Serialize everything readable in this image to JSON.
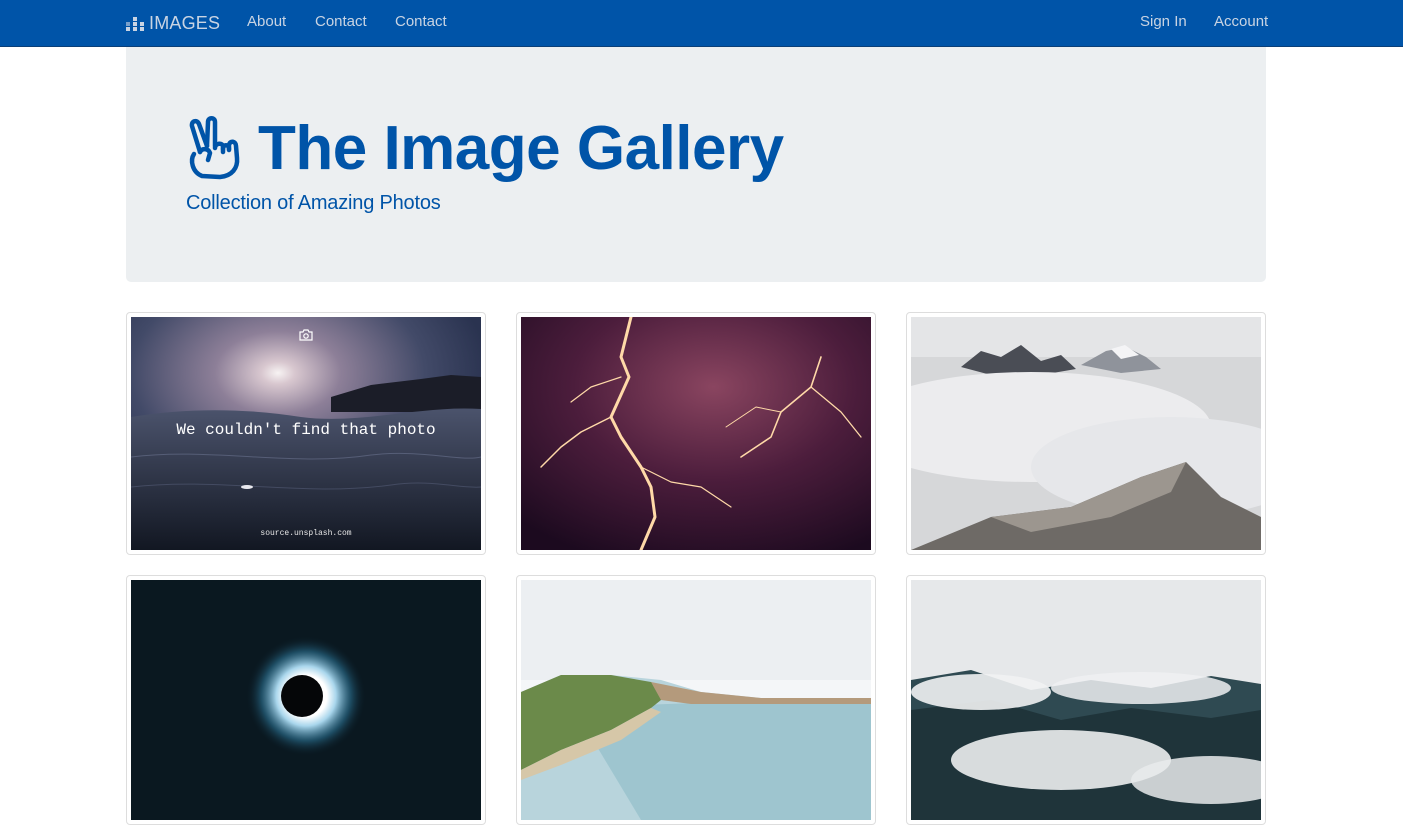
{
  "navbar": {
    "brand_label": "IMAGES",
    "links": [
      "About",
      "Contact",
      "Contact"
    ],
    "right_links": [
      "Sign In",
      "Account"
    ]
  },
  "hero": {
    "title": "The Image Gallery",
    "subtitle": "Collection of Amazing Photos"
  },
  "gallery": {
    "placeholder": {
      "message": "We couldn't find that photo",
      "source": "source.unsplash.com"
    },
    "photos": [
      {
        "icon": "photo-not-found"
      },
      {
        "icon": "lightning-storm"
      },
      {
        "icon": "mountain-above-clouds"
      },
      {
        "icon": "solar-eclipse"
      },
      {
        "icon": "coastal-cliffs"
      },
      {
        "icon": "cloudy-valley"
      }
    ]
  },
  "colors": {
    "navbar_bg": "#0054a8",
    "nav_text": "#c9d4e3",
    "jumbotron_bg": "#eceff1",
    "accent": "#0054a8"
  }
}
